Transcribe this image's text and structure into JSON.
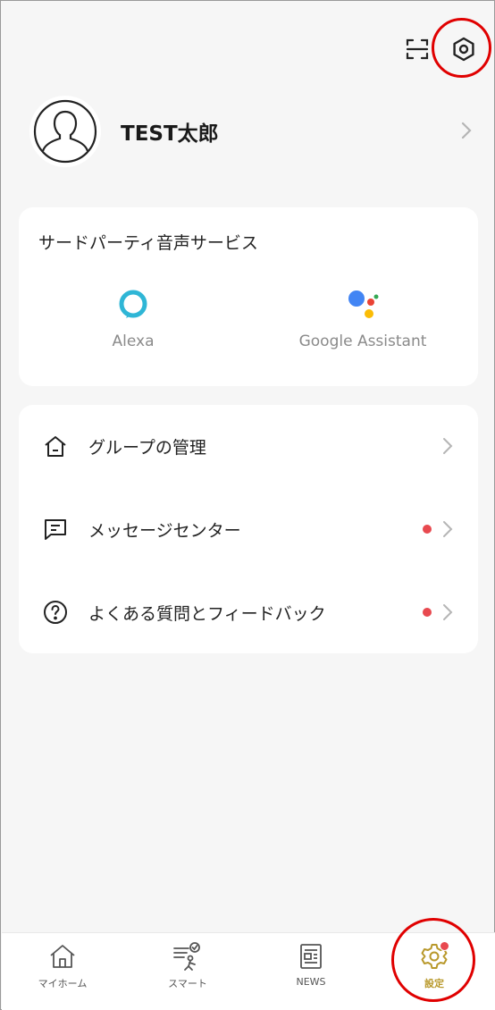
{
  "profile": {
    "name": "TEST太郎"
  },
  "voice_services": {
    "title": "サードパーティ音声サービス",
    "items": [
      {
        "label": "Alexa",
        "icon": "alexa-icon"
      },
      {
        "label": "Google Assistant",
        "icon": "google-assistant-icon"
      }
    ]
  },
  "menu": {
    "items": [
      {
        "label": "グループの管理",
        "icon": "home-icon",
        "badge": false
      },
      {
        "label": "メッセージセンター",
        "icon": "message-icon",
        "badge": true
      },
      {
        "label": "よくある質問とフィードバック",
        "icon": "help-icon",
        "badge": true
      }
    ]
  },
  "tabs": [
    {
      "label": "マイホーム",
      "icon": "home-icon",
      "active": false
    },
    {
      "label": "スマート",
      "icon": "smart-icon",
      "active": false
    },
    {
      "label": "NEWS",
      "icon": "news-icon",
      "active": false
    },
    {
      "label": "設定",
      "icon": "settings-gear-icon",
      "active": true,
      "badge": true
    }
  ],
  "colors": {
    "accent": "#b8982a",
    "badge": "#e8494f",
    "highlight": "#e00000",
    "alexa": "#2fb6d6"
  }
}
